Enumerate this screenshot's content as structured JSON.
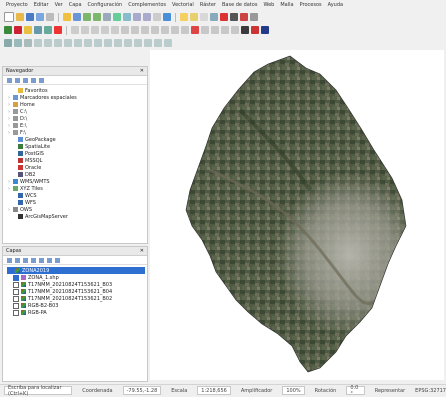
{
  "menu": [
    "Proyecto",
    "Editar",
    "Ver",
    "Capa",
    "Configuración",
    "Complementos",
    "Vectorial",
    "Ráster",
    "Base de datos",
    "Web",
    "Malla",
    "Procesos",
    "Ayuda"
  ],
  "navigator": {
    "title": "Navegador",
    "items": [
      {
        "label": "Favoritos",
        "icon": "star-icon",
        "indent": 1,
        "arrow": ""
      },
      {
        "label": "Marcadores espaciales",
        "icon": "bookmark-icon",
        "indent": 0,
        "arrow": "›"
      },
      {
        "label": "Home",
        "icon": "home-icon",
        "indent": 0,
        "arrow": "›"
      },
      {
        "label": "C:\\",
        "icon": "drive-icon",
        "indent": 0,
        "arrow": "›"
      },
      {
        "label": "D:\\",
        "icon": "drive-icon",
        "indent": 0,
        "arrow": "›"
      },
      {
        "label": "E:\\",
        "icon": "drive-icon",
        "indent": 0,
        "arrow": "›"
      },
      {
        "label": "F:\\",
        "icon": "drive-icon",
        "indent": 0,
        "arrow": "›"
      },
      {
        "label": "GeoPackage",
        "icon": "geopackage-icon",
        "indent": 1,
        "arrow": ""
      },
      {
        "label": "SpatiaLite",
        "icon": "spatialite-icon",
        "indent": 1,
        "arrow": ""
      },
      {
        "label": "PostGIS",
        "icon": "postgis-icon",
        "indent": 1,
        "arrow": ""
      },
      {
        "label": "MSSQL",
        "icon": "mssql-icon",
        "indent": 1,
        "arrow": ""
      },
      {
        "label": "Oracle",
        "icon": "oracle-icon",
        "indent": 1,
        "arrow": ""
      },
      {
        "label": "DB2",
        "icon": "db2-icon",
        "indent": 1,
        "arrow": ""
      },
      {
        "label": "WMS/WMTS",
        "icon": "wms-icon",
        "indent": 0,
        "arrow": "›"
      },
      {
        "label": "XYZ Tiles",
        "icon": "xyz-icon",
        "indent": 0,
        "arrow": "›"
      },
      {
        "label": "WCS",
        "icon": "wcs-icon",
        "indent": 1,
        "arrow": ""
      },
      {
        "label": "WFS",
        "icon": "wfs-icon",
        "indent": 1,
        "arrow": ""
      },
      {
        "label": "OWS",
        "icon": "ows-icon",
        "indent": 0,
        "arrow": "›"
      },
      {
        "label": "ArcGisMapServer",
        "icon": "arcgis-icon",
        "indent": 1,
        "arrow": ""
      }
    ]
  },
  "layers": {
    "title": "Capas",
    "items": [
      {
        "label": "ZONA2019",
        "checked": true,
        "selected": true,
        "icon": "raster-icon",
        "indent": 0
      },
      {
        "label": "ZONA_1.shp",
        "checked": true,
        "selected": false,
        "icon": "polygon-icon",
        "indent": 1
      },
      {
        "label": "T17NMM_20210824T153621_B03",
        "checked": false,
        "selected": false,
        "icon": "raster-icon",
        "indent": 1
      },
      {
        "label": "T17NMM_20210824T153621_B04",
        "checked": false,
        "selected": false,
        "icon": "raster-icon",
        "indent": 1
      },
      {
        "label": "T17NMM_20210824T153621_B02",
        "checked": false,
        "selected": false,
        "icon": "raster-icon",
        "indent": 1
      },
      {
        "label": "RGB-B2-B03",
        "checked": false,
        "selected": false,
        "icon": "raster-icon",
        "indent": 1
      },
      {
        "label": "RGB-PA",
        "checked": false,
        "selected": false,
        "icon": "raster-icon",
        "indent": 1
      }
    ]
  },
  "status": {
    "search_placeholder": "Escriba para localizar (Ctrl+K)",
    "coordinate_label": "Coordenada",
    "coordinate": "-79.55,-1.28",
    "scale_label": "Escala",
    "scale": "1:218,656",
    "magnifier_label": "Amplificador",
    "magnifier": "100%",
    "rotation_label": "Rotación",
    "rotation": "0.0 °",
    "render_label": "Representar",
    "crs": "EPSG:32717"
  }
}
